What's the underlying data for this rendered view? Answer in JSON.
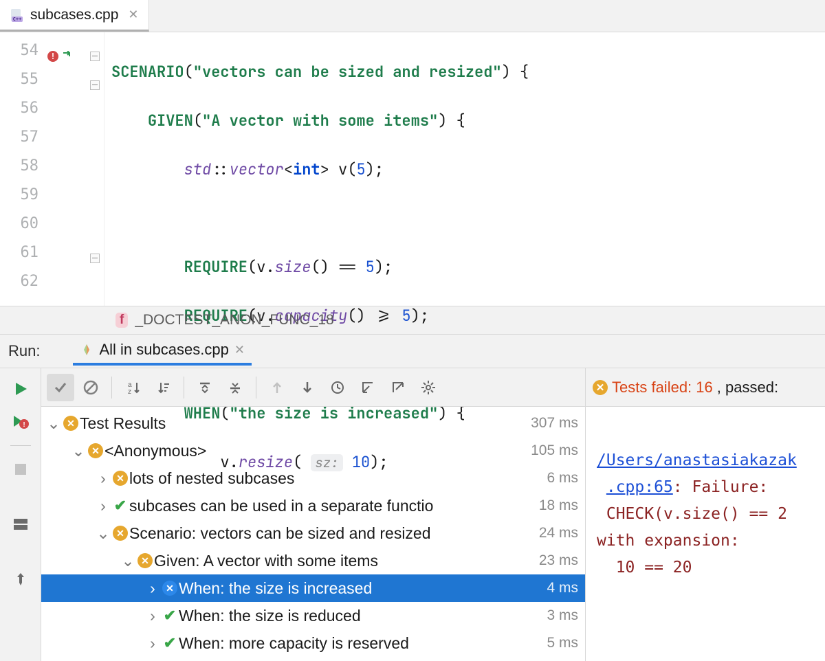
{
  "tab": {
    "filename": "subcases.cpp",
    "icon": "cpp-file-icon"
  },
  "editor": {
    "lines": [
      54,
      55,
      56,
      57,
      58,
      59,
      60,
      61,
      62
    ]
  },
  "code": {
    "l54_kw": "SCENARIO",
    "l54_str": "\"vectors can be sized and resized\"",
    "l55_kw": "GIVEN",
    "l55_str": "\"A vector with some items\"",
    "l56_ns": "std",
    "l56_tpl": "vector",
    "l56_type": "int",
    "l56_var": "v",
    "l56_num": "5",
    "l58_kw": "REQUIRE",
    "l58_expr_lhs": "v.",
    "l58_fn": "size",
    "l58_op": "==",
    "l58_num": "5",
    "l59_kw": "REQUIRE",
    "l59_expr_lhs": "v.",
    "l59_fn": "capacity",
    "l59_op": ">=",
    "l59_num": "5",
    "l61_kw": "WHEN",
    "l61_str": "\"the size is increased\"",
    "l62_expr": "v.",
    "l62_fn": "resize",
    "l62_hint": "sz:",
    "l62_num": "10"
  },
  "breadcrumb": {
    "fn_label": "_DOCTEST_ANON_FUNC_18"
  },
  "run": {
    "panel_label": "Run:",
    "tab_label": "All in subcases.cpp",
    "status_label_fail": "Tests failed:",
    "status_count": "16",
    "status_passed_prefix": ", passed:"
  },
  "tree": {
    "root": {
      "label": "Test Results",
      "time": "307 ms"
    },
    "items": [
      {
        "indent": 1,
        "status": "fail",
        "chev": "v",
        "label": "<Anonymous>",
        "time": "105 ms"
      },
      {
        "indent": 2,
        "status": "fail",
        "chev": ">",
        "label": "lots of nested subcases",
        "time": "6 ms"
      },
      {
        "indent": 2,
        "status": "pass",
        "chev": ">",
        "label": "subcases can be used in a separate functio",
        "time": "18 ms"
      },
      {
        "indent": 2,
        "status": "fail",
        "chev": "v",
        "label": "Scenario: vectors can be sized and resized",
        "time": "24 ms"
      },
      {
        "indent": 3,
        "status": "fail",
        "chev": "v",
        "label": "Given: A vector with some items",
        "time": "23 ms"
      },
      {
        "indent": 4,
        "status": "fail",
        "chev": ">",
        "label": "When: the size is increased",
        "time": "4 ms",
        "selected": true
      },
      {
        "indent": 4,
        "status": "pass",
        "chev": ">",
        "label": "When: the size is reduced",
        "time": "3 ms"
      },
      {
        "indent": 4,
        "status": "pass",
        "chev": ">",
        "label": "When: more capacity is reserved",
        "time": "5 ms"
      }
    ]
  },
  "console": {
    "link": "/Users/anastasiakazak",
    "line1a": ".cpp:65",
    "line1b": ": Failure:",
    "line2": "CHECK(v.size() == 2",
    "line3": "with expansion:",
    "line4": "  10 == 20"
  }
}
